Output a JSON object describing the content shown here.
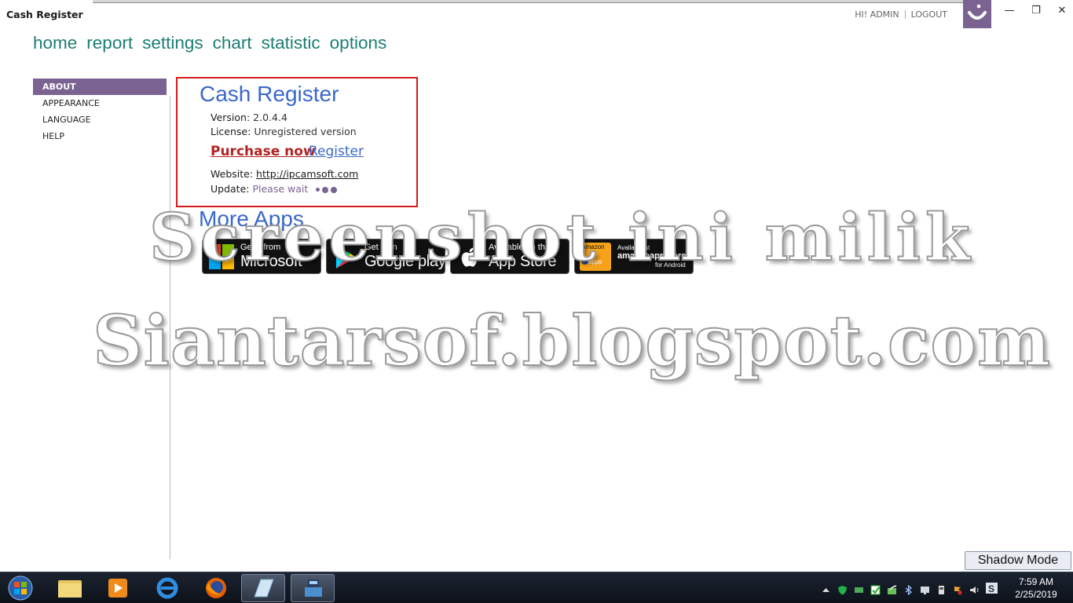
{
  "window": {
    "title": "Cash Register",
    "user_greeting": "HI! ADMIN",
    "logout_label": "LOGOUT",
    "minimize_glyph": "—",
    "restore_glyph": "❐",
    "close_glyph": "✕"
  },
  "nav": {
    "items": [
      {
        "label": "home"
      },
      {
        "label": "report"
      },
      {
        "label": "settings"
      },
      {
        "label": "chart"
      },
      {
        "label": "statistic"
      },
      {
        "label": "options"
      }
    ]
  },
  "sidebar": {
    "items": [
      {
        "label": "ABOUT",
        "active": true
      },
      {
        "label": "APPEARANCE",
        "active": false
      },
      {
        "label": "LANGUAGE",
        "active": false
      },
      {
        "label": "HELP",
        "active": false
      }
    ]
  },
  "about": {
    "title": "Cash Register",
    "version_label": "Version:",
    "version_value": "2.0.4.4",
    "license_label": "License:",
    "license_value": "Unregistered version",
    "purchase_label": "Purchase now",
    "register_label": "Register",
    "website_label": "Website:",
    "website_value": "http://ipcamsoft.com",
    "update_label": "Update:",
    "update_value": "Please wait"
  },
  "more_apps": {
    "title": "More Apps",
    "badges": [
      {
        "small": "Get it from",
        "big": "Microsoft",
        "icon": "microsoft-logo"
      },
      {
        "small": "Get it on",
        "big": "Google play",
        "icon": "google-play-logo"
      },
      {
        "small": "Available on the",
        "big": "App Store",
        "icon": "apple-logo"
      },
      {
        "small": "Available at",
        "big": "amazonappstore",
        "extra": "for Android",
        "icon_text": "amazon",
        "icon_sub": "apps",
        "icon": "amazon-apps-logo"
      }
    ]
  },
  "watermark": {
    "line1": "Screenshot ini milik",
    "line2": "Siantarsof.blogspot.com"
  },
  "shadow_mode_label": "Shadow Mode",
  "taskbar": {
    "time": "7:59 AM",
    "date": "2/25/2019",
    "apps": [
      "file-explorer",
      "media-player",
      "internet-explorer",
      "firefox",
      "notepad-app",
      "cash-register-app"
    ]
  },
  "colors": {
    "accent_purple": "#7b6391",
    "nav_teal": "#1a7e72",
    "title_blue": "#3a68c8",
    "purchase_red": "#b22222",
    "panel_border_red": "#d51a1a"
  }
}
